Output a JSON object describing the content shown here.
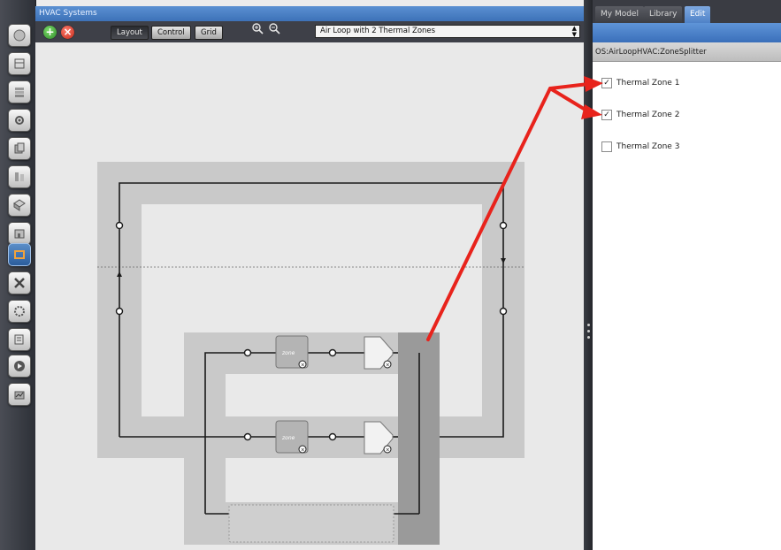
{
  "window": {
    "title": "HVAC Systems"
  },
  "toolbar": {
    "buttons": [
      "Layout",
      "Control",
      "Grid"
    ],
    "active_view": "Layout",
    "loop_select": "Air Loop with 2 Thermal Zones"
  },
  "left_tools": [
    "sphere-icon",
    "building-icon",
    "constructions-icon",
    "gear-icon",
    "loads-icon",
    "space-types-icon",
    "geometry-icon",
    "facility-icon",
    "hvac-systems-icon",
    "scripts-icon",
    "settings-icon",
    "results-icon",
    "run-icon",
    "summary-icon"
  ],
  "diagram": {
    "zone_label": "zone",
    "branch_count": 2
  },
  "right_panel": {
    "tabs": [
      "My Model",
      "Library",
      "Edit"
    ],
    "active_tab": "Edit",
    "header": "OS:AirLoopHVAC:ZoneSplitter",
    "zones": [
      {
        "label": "Thermal Zone 1",
        "checked": true
      },
      {
        "label": "Thermal Zone 2",
        "checked": true
      },
      {
        "label": "Thermal Zone 3",
        "checked": false
      }
    ]
  },
  "colors": {
    "annotation_arrow": "#e8231c",
    "accent_blue": "#4a80c4"
  }
}
